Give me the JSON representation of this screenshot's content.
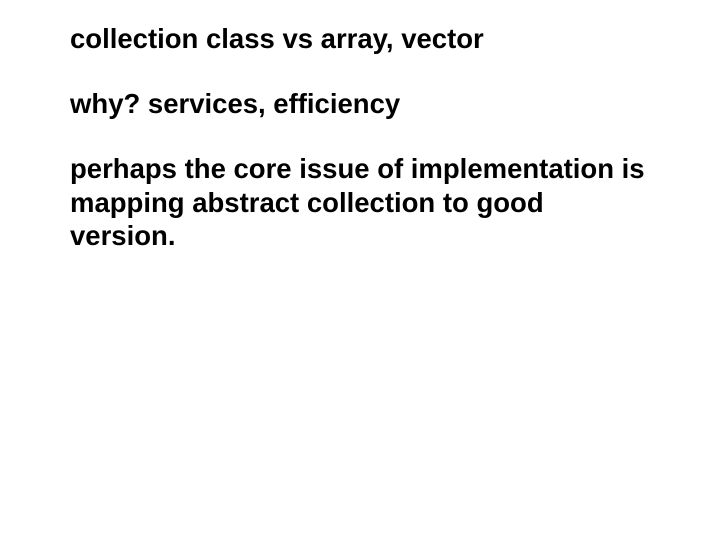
{
  "slide": {
    "line1": "collection class vs array, vector",
    "line2": "why?   services, efficiency",
    "paragraph": "perhaps the core issue of implementation is mapping abstract collection to good version."
  }
}
